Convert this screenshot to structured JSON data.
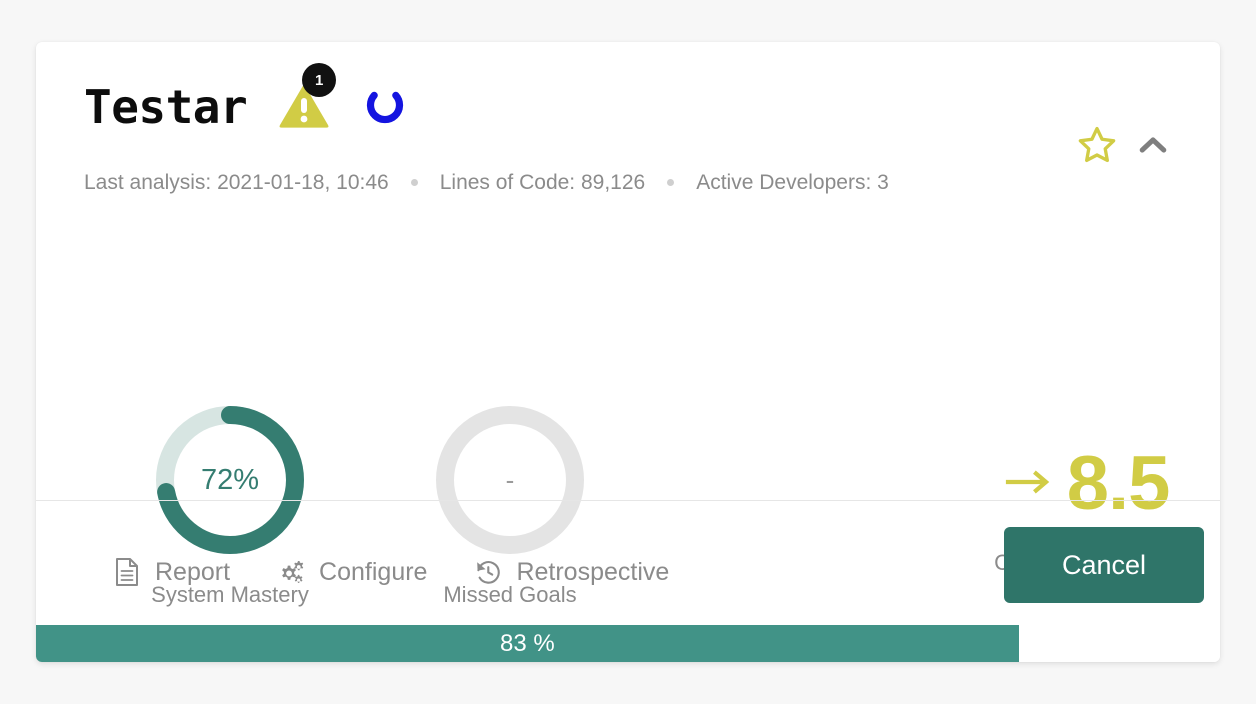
{
  "theme": {
    "page_background": "#f7f7f7",
    "card_background": "#ffffff",
    "accent_teal": "#2f7569",
    "progress_teal": "#419387",
    "donut_teal": "#357d71",
    "donut_track_teal": "#d7e5e2",
    "donut_track_gray": "#e4e4e4",
    "accent_yellow": "#d1cc45",
    "spinner_blue": "#1414e0",
    "badge_black": "#111111",
    "muted_text": "#8b8b8b"
  },
  "header": {
    "title": "Testar",
    "warning_icon": "warning-triangle-icon",
    "warning_badge_count": "1",
    "loading_icon": "spinner-icon",
    "favorite_icon": "star-outline-icon",
    "collapse_icon": "chevron-up-icon"
  },
  "meta": {
    "items": [
      "Last analysis: 2021-01-18, 10:46",
      "Lines of Code: 89,126",
      "Active Developers: 3"
    ]
  },
  "metrics": [
    {
      "id": "system-mastery",
      "caption": "System Mastery",
      "value_label": "72%",
      "percent": 72,
      "state": "filled"
    },
    {
      "id": "missed-goals",
      "caption": "Missed Goals",
      "value_label": "-",
      "percent": 0,
      "state": "empty"
    }
  ],
  "score": {
    "caption": "Code Health Score",
    "value": "8.5",
    "trend_icon": "arrow-right-icon",
    "trend": "flat"
  },
  "footer": {
    "actions": [
      {
        "id": "report",
        "label": "Report",
        "icon": "document-icon"
      },
      {
        "id": "configure",
        "label": "Configure",
        "icon": "gears-icon"
      },
      {
        "id": "retrospective",
        "label": "Retrospective",
        "icon": "history-icon"
      }
    ],
    "cancel_label": "Cancel"
  },
  "progress": {
    "label": "83 %",
    "percent": 83
  }
}
